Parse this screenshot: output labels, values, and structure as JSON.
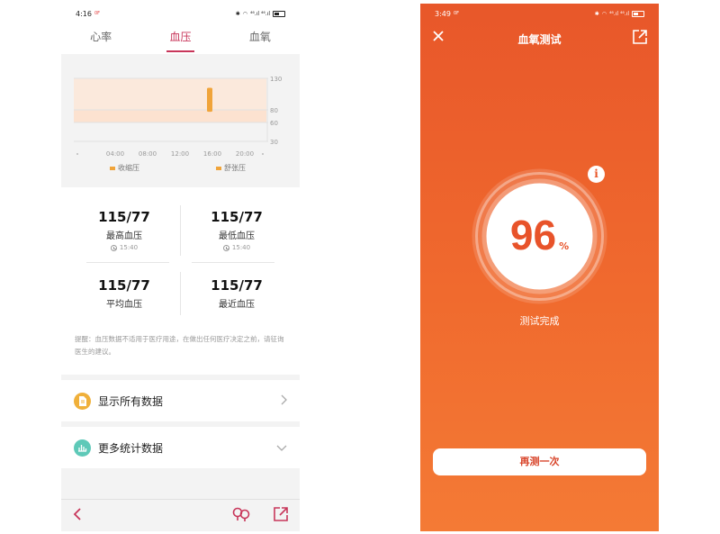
{
  "left": {
    "status": {
      "time": "4:16",
      "net": "0F",
      "signal": "⁴⁶.ıl ⁴⁶.ıl"
    },
    "tabs": [
      {
        "label": "心率"
      },
      {
        "label": "血压"
      },
      {
        "label": "血氧"
      }
    ],
    "chart_data": {
      "type": "bar",
      "x_ticks": [
        "04:00",
        "08:00",
        "12:00",
        "16:00",
        "20:00"
      ],
      "y_ticks": [
        130,
        80,
        60,
        30
      ],
      "ylim": [
        30,
        130
      ],
      "series": [
        {
          "name": "收缩压",
          "color": "#f0a43a"
        },
        {
          "name": "舒张压",
          "color": "#f0a43a"
        }
      ],
      "reference_bands": [
        {
          "from": 80,
          "to": 130,
          "color": "#fbe9dc"
        },
        {
          "from": 60,
          "to": 80,
          "color": "#fce2d0"
        }
      ],
      "points": [
        {
          "x": "15:40",
          "systolic": 115,
          "diastolic": 77
        }
      ]
    },
    "stats": [
      {
        "value": "115/77",
        "label": "最高血压",
        "time": "15:40"
      },
      {
        "value": "115/77",
        "label": "最低血压",
        "time": "15:40"
      },
      {
        "value": "115/77",
        "label": "平均血压"
      },
      {
        "value": "115/77",
        "label": "最近血压"
      }
    ],
    "disclaimer": "提醒：血压数据不适用于医疗用途，在做出任何医疗决定之前，请征询医生的建议。",
    "rows": [
      {
        "label": "显示所有数据",
        "icon": "document-icon",
        "color": "#f0b03a"
      },
      {
        "label": "更多统计数据",
        "icon": "bar-chart-icon",
        "color": "#5ec9b8"
      }
    ]
  },
  "right": {
    "status": {
      "time": "3:49",
      "net": "0F",
      "signal": "⁴⁶.ıl ⁴⁶.ıl"
    },
    "title": "血氧测试",
    "result": {
      "value": "96",
      "unit": "%",
      "progress": 0.96
    },
    "status_text": "测试完成",
    "retry_label": "再测一次",
    "accent": "#e8572a"
  }
}
